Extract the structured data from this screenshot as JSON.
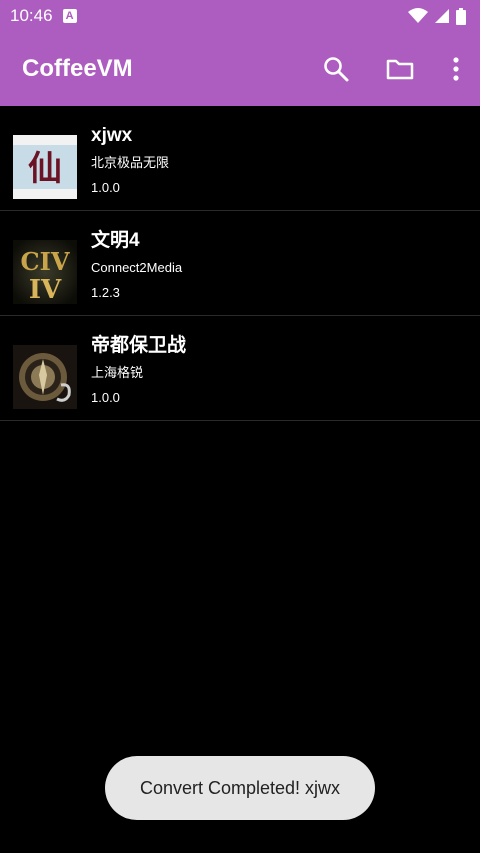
{
  "status_bar": {
    "time": "10:46",
    "notification_icon": "a-letter-icon",
    "icons": [
      "wifi-icon",
      "signal-icon",
      "battery-icon"
    ]
  },
  "app_bar": {
    "title": "CoffeeVM",
    "actions": [
      "search-icon",
      "folder-icon",
      "more-vert-icon"
    ],
    "color": "#ad5cbf"
  },
  "games": [
    {
      "title": "xjwx",
      "publisher": "北京极品无限",
      "version": "1.0.0",
      "icon_glyph": "仙"
    },
    {
      "title": "文明4",
      "publisher": "Connect2Media",
      "version": "1.2.3",
      "icon_glyph": "CIV IV"
    },
    {
      "title": "帝都保卫战",
      "publisher": "上海格锐",
      "version": "1.0.0",
      "icon_glyph": "emblem"
    }
  ],
  "toast": {
    "message": "Convert Completed! xjwx"
  }
}
